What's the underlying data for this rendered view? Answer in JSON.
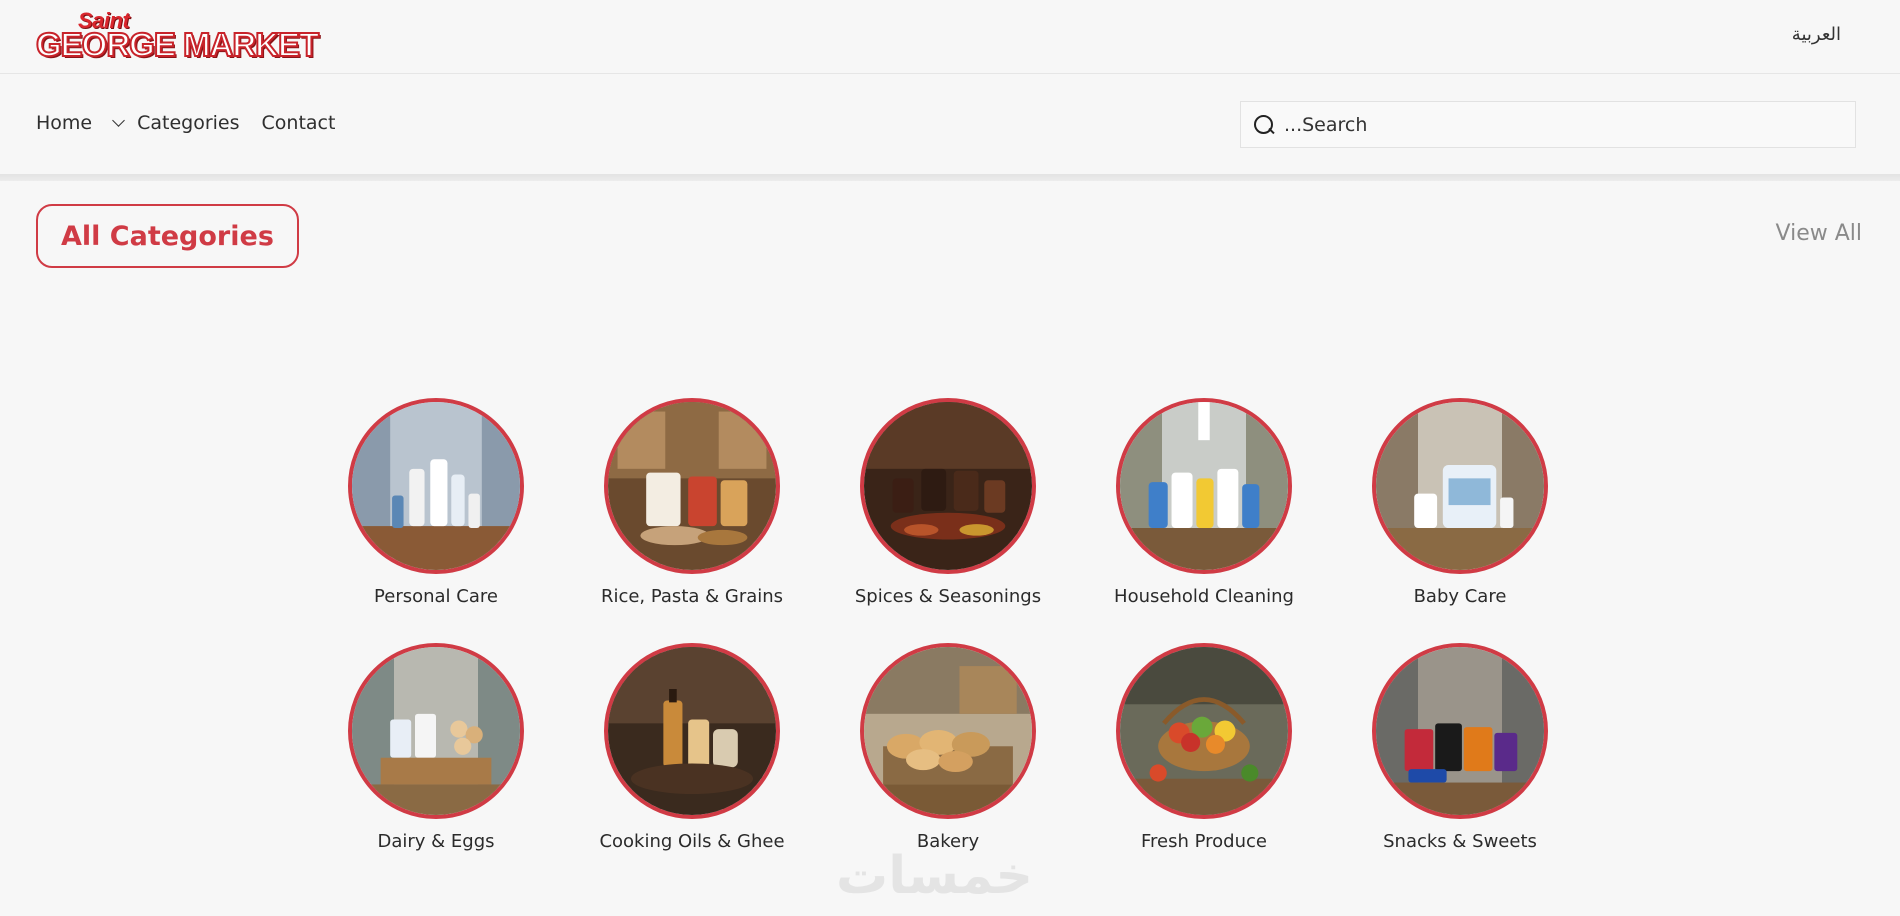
{
  "header": {
    "logo_top": "Saint",
    "logo_main": "GEORGE MARKET",
    "language_link": "العربية"
  },
  "nav": {
    "home": "Home",
    "categories": "Categories",
    "contact": "Contact",
    "search_placeholder": "...Search"
  },
  "section": {
    "title": "All Categories",
    "view_all": "View All"
  },
  "categories": [
    {
      "label": "Personal Care",
      "icon": "personal-care-image",
      "color": "#5a87b5"
    },
    {
      "label": "Rice, Pasta & Grains",
      "icon": "rice-pasta-grains-image",
      "color": "#a86d3a"
    },
    {
      "label": "Spices & Seasonings",
      "icon": "spices-seasonings-image",
      "color": "#6b3a22"
    },
    {
      "label": "Household Cleaning",
      "icon": "household-cleaning-image",
      "color": "#3f7fc9"
    },
    {
      "label": "Baby Care",
      "icon": "baby-care-image",
      "color": "#8fb8d9"
    },
    {
      "label": "Dairy & Eggs",
      "icon": "dairy-eggs-image",
      "color": "#c9a06d"
    },
    {
      "label": "Cooking Oils & Ghee",
      "icon": "cooking-oils-ghee-image",
      "color": "#7a4a24"
    },
    {
      "label": "Bakery",
      "icon": "bakery-image",
      "color": "#c99a5a"
    },
    {
      "label": "Fresh Produce",
      "icon": "fresh-produce-image",
      "color": "#d94a2a"
    },
    {
      "label": "Snacks & Sweets",
      "icon": "snacks-sweets-image",
      "color": "#c32a3a"
    }
  ],
  "watermark": "خمسات",
  "colors": {
    "accent": "#d03b45",
    "background": "#f7f7f7",
    "muted": "#8a8a8a"
  }
}
